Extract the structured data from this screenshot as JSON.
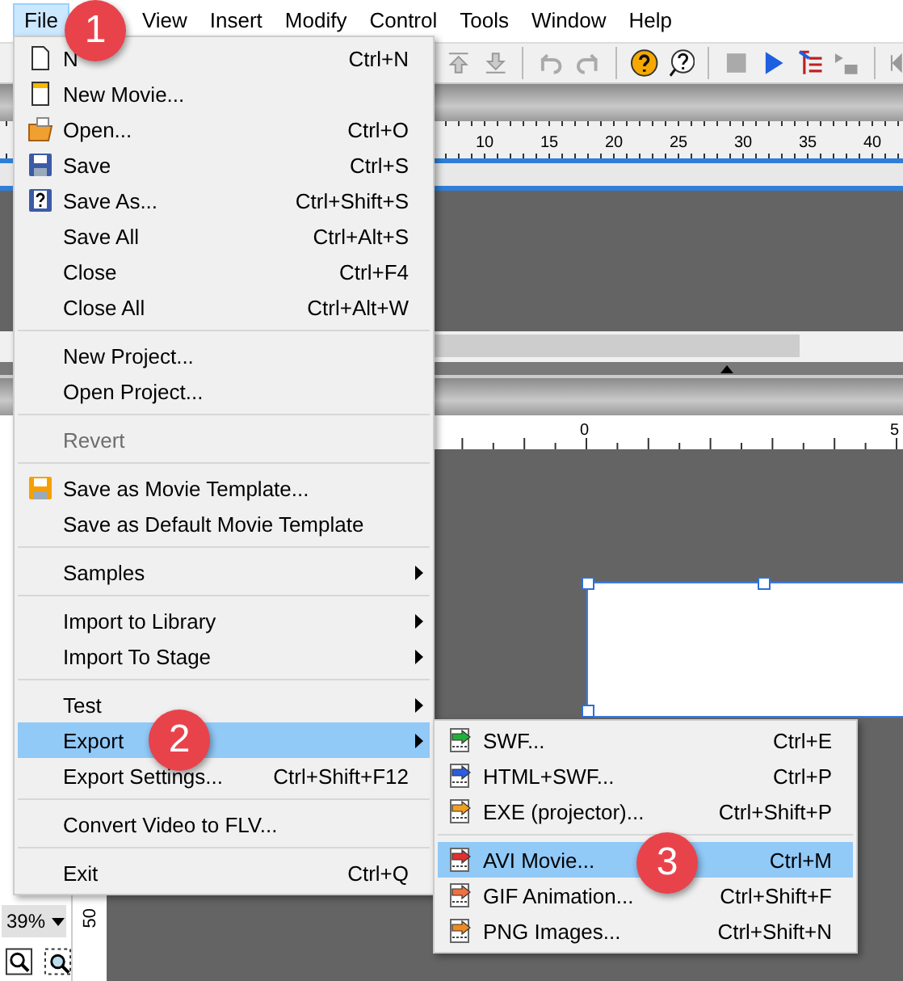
{
  "menubar": [
    {
      "label": "File",
      "selected": true
    },
    {
      "label": "View",
      "selected": false
    },
    {
      "label": "Insert",
      "selected": false
    },
    {
      "label": "Modify",
      "selected": false
    },
    {
      "label": "Control",
      "selected": false
    },
    {
      "label": "Tools",
      "selected": false
    },
    {
      "label": "Window",
      "selected": false
    },
    {
      "label": "Help",
      "selected": false
    }
  ],
  "timeline_ruler": {
    "labels": [
      "10",
      "15",
      "20",
      "25",
      "30",
      "35",
      "40"
    ]
  },
  "stage_ruler": {
    "labels": [
      "0",
      "5"
    ]
  },
  "vertical_ruler": {
    "labels": [
      "50"
    ]
  },
  "zoom": {
    "value": "39%"
  },
  "file_menu": [
    {
      "kind": "item",
      "label": "N",
      "shortcut": "Ctrl+N",
      "disabled": false,
      "submenu": false,
      "selected": false
    },
    {
      "kind": "item",
      "label": "New Movie...",
      "disabled": false,
      "submenu": false,
      "selected": false
    },
    {
      "kind": "item",
      "label": "Open...",
      "shortcut": "Ctrl+O",
      "disabled": false,
      "submenu": false,
      "selected": false
    },
    {
      "kind": "item",
      "label": "Save",
      "shortcut": "Ctrl+S",
      "disabled": false,
      "submenu": false,
      "selected": false
    },
    {
      "kind": "item",
      "label": "Save As...",
      "shortcut": "Ctrl+Shift+S",
      "disabled": false,
      "submenu": false,
      "selected": false
    },
    {
      "kind": "item",
      "label": "Save All",
      "shortcut": "Ctrl+Alt+S",
      "disabled": false,
      "submenu": false,
      "selected": false
    },
    {
      "kind": "item",
      "label": "Close",
      "shortcut": "Ctrl+F4",
      "disabled": false,
      "submenu": false,
      "selected": false
    },
    {
      "kind": "item",
      "label": "Close All",
      "shortcut": "Ctrl+Alt+W",
      "disabled": false,
      "submenu": false,
      "selected": false
    },
    {
      "kind": "separator"
    },
    {
      "kind": "item",
      "label": "New Project...",
      "disabled": false,
      "submenu": false,
      "selected": false
    },
    {
      "kind": "item",
      "label": "Open Project...",
      "disabled": false,
      "submenu": false,
      "selected": false
    },
    {
      "kind": "separator"
    },
    {
      "kind": "item",
      "label": "Revert",
      "disabled": true,
      "submenu": false,
      "selected": false
    },
    {
      "kind": "separator"
    },
    {
      "kind": "item",
      "label": "Save as Movie Template...",
      "disabled": false,
      "submenu": false,
      "selected": false
    },
    {
      "kind": "item",
      "label": "Save as Default Movie Template",
      "disabled": false,
      "submenu": false,
      "selected": false
    },
    {
      "kind": "separator"
    },
    {
      "kind": "item",
      "label": "Samples",
      "disabled": false,
      "submenu": true,
      "selected": false
    },
    {
      "kind": "separator"
    },
    {
      "kind": "item",
      "label": "Import to Library",
      "disabled": false,
      "submenu": true,
      "selected": false
    },
    {
      "kind": "item",
      "label": "Import To Stage",
      "disabled": false,
      "submenu": true,
      "selected": false
    },
    {
      "kind": "separator"
    },
    {
      "kind": "item",
      "label": "Test",
      "disabled": false,
      "submenu": true,
      "selected": false
    },
    {
      "kind": "item",
      "label": "Export",
      "disabled": false,
      "submenu": true,
      "selected": true
    },
    {
      "kind": "item",
      "label": "Export Settings...",
      "shortcut": "Ctrl+Shift+F12",
      "disabled": false,
      "submenu": false,
      "selected": false
    },
    {
      "kind": "separator"
    },
    {
      "kind": "item",
      "label": "Convert Video to FLV...",
      "disabled": false,
      "submenu": false,
      "selected": false
    },
    {
      "kind": "separator"
    },
    {
      "kind": "item",
      "label": "Exit",
      "shortcut": "Ctrl+Q",
      "disabled": false,
      "submenu": false,
      "selected": false
    }
  ],
  "export_menu": [
    {
      "kind": "item",
      "label": "SWF...",
      "shortcut": "Ctrl+E",
      "selected": false
    },
    {
      "kind": "item",
      "label": "HTML+SWF...",
      "shortcut": "Ctrl+P",
      "selected": false
    },
    {
      "kind": "item",
      "label": "EXE (projector)...",
      "shortcut": "Ctrl+Shift+P",
      "selected": false
    },
    {
      "kind": "separator"
    },
    {
      "kind": "item",
      "label": "AVI Movie...",
      "shortcut": "Ctrl+M",
      "selected": true
    },
    {
      "kind": "item",
      "label": "GIF Animation...",
      "shortcut": "Ctrl+Shift+F",
      "selected": false
    },
    {
      "kind": "item",
      "label": "PNG Images...",
      "shortcut": "Ctrl+Shift+N",
      "selected": false
    }
  ],
  "callouts": [
    {
      "label": "1"
    },
    {
      "label": "2"
    },
    {
      "label": "3"
    }
  ]
}
